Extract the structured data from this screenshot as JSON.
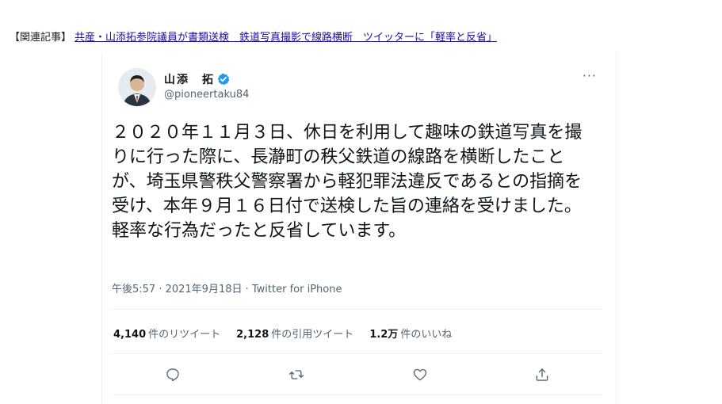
{
  "related": {
    "prefix": "【関連記事】",
    "link_text": "共産・山添拓参院議員が書類送検　鉄道写真撮影で線路横断　ツイッターに「軽率と反省」"
  },
  "tweet": {
    "author_name": "山添　拓",
    "handle": "@pioneertaku84",
    "more_label": "···",
    "text": "２０２０年１１月３日、休日を利用して趣味の鉄道写真を撮りに行った際に、長瀞町の秩父鉄道の線路を横断したことが、埼玉県警秩父警察署から軽犯罪法違反であるとの指摘を受け、本年９月１６日付で送検した旨の連絡を受けました。軽率な行為だったと反省しています。",
    "timestamp": "午後5:57 · 2021年9月18日 · Twitter for iPhone",
    "stats": {
      "retweets_count": "4,140",
      "retweets_label": "件のリツイート",
      "quotes_count": "2,128",
      "quotes_label": "件の引用ツイート",
      "likes_count": "1.2万",
      "likes_label": "件のいいね"
    },
    "icons": {
      "reply": "reply-icon",
      "retweet": "retweet-icon",
      "like": "like-icon",
      "share": "share-icon",
      "verified": "verified-badge-icon"
    },
    "colors": {
      "verified": "#1d9bf0",
      "link": "#1a0dab",
      "text": "#0f1419",
      "muted": "#536471"
    }
  }
}
